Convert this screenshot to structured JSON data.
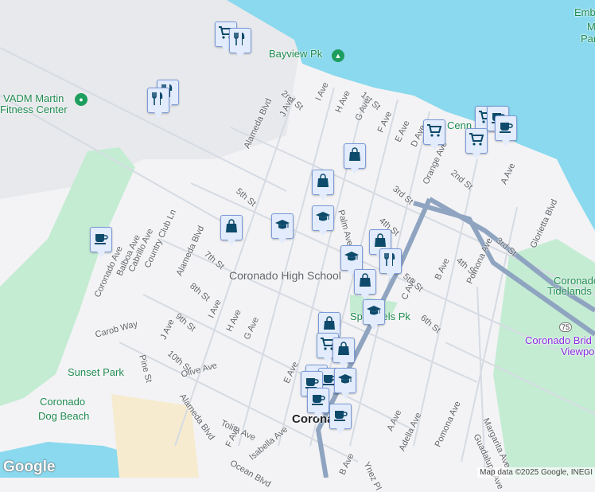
{
  "colors": {
    "water": "#8ad9ee",
    "park": "#c4ecd3",
    "land": "#f3f3f5",
    "base": "#e8e9ec",
    "road": "#d6dbe3",
    "highway": "#8fa4c0",
    "sand": "#f6ebcf",
    "marker_fill": "#e3ecfc",
    "marker_icon": "#0d4a6b"
  },
  "places": {
    "bayview": "Bayview Pk",
    "vadm": "VADM Martin",
    "vadm2": "Fitness Center",
    "emb1": "Emb",
    "emb2": "M",
    "emb3": "Par",
    "high_school": "Coronado High School",
    "spreckels": "Spreckels Pk",
    "tidelands1": "Coronado",
    "tidelands2": "Tidelands",
    "bridge1": "Coronado Brid",
    "bridge2": "Viewpo",
    "sunset": "Sunset Park",
    "dog1": "Coronado",
    "dog2": "Dog Beach",
    "town": "Coronado",
    "centennial": "Cenn"
  },
  "streets": [
    "Alameda Blvd",
    "2nd St",
    "1st St",
    "I Ave",
    "H Ave",
    "G Ave",
    "F Ave",
    "E Ave",
    "J Ave",
    "D Ave",
    "Orange Ave",
    "2nd St",
    "3rd St",
    "A Ave",
    "5th St",
    "4th St",
    "3rd St",
    "Palm Ave",
    "7th St",
    "Alameda Blvd",
    "Glorietta Blvd",
    "4th St",
    "5th St",
    "B Ave",
    "C Ave",
    "8th St",
    "6th St",
    "Pomona Ave",
    "Coronado Ave",
    "Balboa Ave",
    "Cabrillo Ave",
    "Country Club Ln",
    "9th St",
    "I Ave",
    "H Ave",
    "G Ave",
    "J Ave",
    "Carob Way",
    "10th St",
    "Olive Ave",
    "Pine St",
    "E Ave",
    "Alameda Blvd",
    "Tolita Ave",
    "F Ave",
    "Isabella Ave",
    "Ocean Blvd",
    "A Ave",
    "Adella Ave",
    "Pomona Ave",
    "Margarita Ave",
    "Guadalupe Ave",
    "B Ave",
    "Ynez Pl"
  ],
  "highway_shield": "75",
  "markers": [
    "shopping-cart",
    "restaurant",
    "restaurant",
    "restaurant",
    "shopping-cart",
    "shopping-cart",
    "coffee",
    "coffee",
    "shopping-cart",
    "shopping-bag",
    "shopping-bag",
    "school",
    "school",
    "shopping-bag",
    "coffee",
    "shopping-bag",
    "school",
    "restaurant",
    "shopping-bag",
    "school",
    "shopping-bag",
    "shopping-cart",
    "shopping-bag",
    "coffee",
    "coffee",
    "school",
    "coffee",
    "coffee",
    "coffee"
  ],
  "logo": "Google",
  "attribution": "Map data ©2025 Google, INEGI"
}
